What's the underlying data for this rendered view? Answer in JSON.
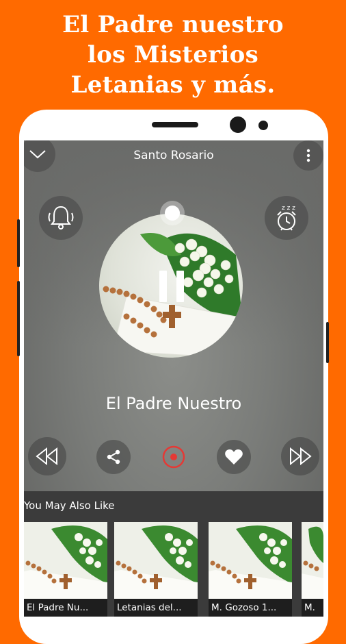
{
  "promo": {
    "line1": "El Padre nuestro",
    "line2": "los Misterios",
    "line3": "Letanias y más."
  },
  "header": {
    "title": "Santo Rosario",
    "collapse_icon": "chevron-down-icon",
    "menu_icon": "more-vertical-icon"
  },
  "player": {
    "bell_icon": "bell-icon",
    "sleep_timer_icon": "alarm-clock-sleep-icon",
    "play_state_icon": "pause-icon",
    "now_playing": "El Padre Nuestro",
    "controls": [
      "rewind-icon",
      "share-icon",
      "record-icon",
      "heart-icon",
      "fast-forward-icon"
    ],
    "accent_color": "#E53935"
  },
  "recommendations": {
    "title": "You May Also Like",
    "items": [
      {
        "label": "El Padre Nu..."
      },
      {
        "label": "Letanias del..."
      },
      {
        "label": "M. Gozoso 1..."
      },
      {
        "label": "M."
      }
    ]
  },
  "colors": {
    "background": "#FF6A00",
    "promo_text": "#FFFFFF"
  }
}
